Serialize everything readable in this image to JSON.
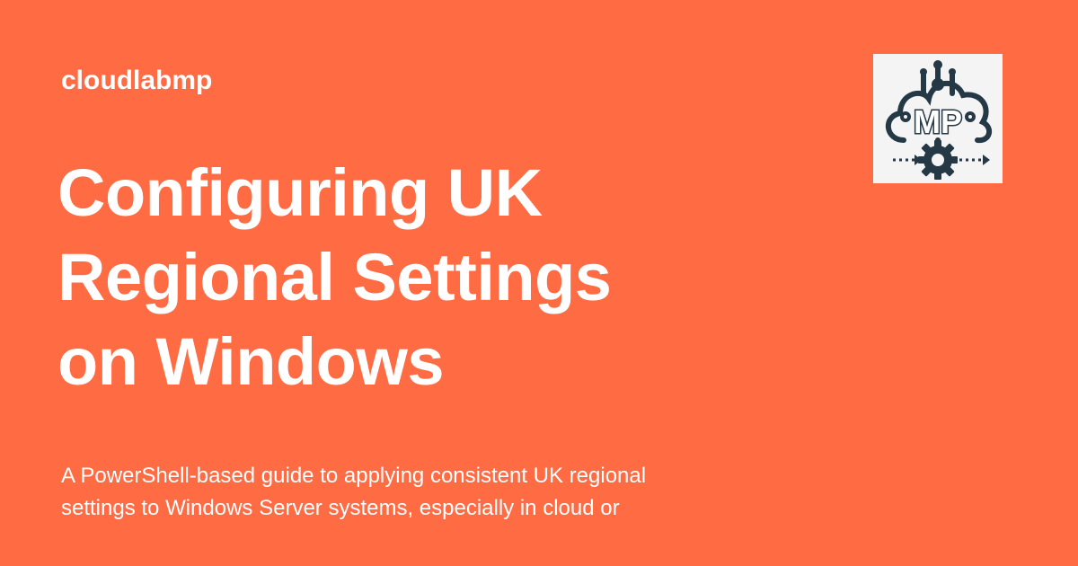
{
  "site": {
    "name": "cloudlabmp"
  },
  "page": {
    "title_lines": [
      "Configuring UK",
      "Regional Settings",
      "on Windows"
    ],
    "description_lines": [
      "A PowerShell-based guide to applying consistent UK regional",
      "settings to Windows Server systems, especially in cloud or"
    ]
  },
  "logo": {
    "icon": "cloud-gear-logo-icon",
    "text": "MP",
    "colors": {
      "background": "#f4f4f4",
      "ink": "#243845"
    }
  },
  "colors": {
    "background": "#ff6b42",
    "text": "#ffffff"
  }
}
